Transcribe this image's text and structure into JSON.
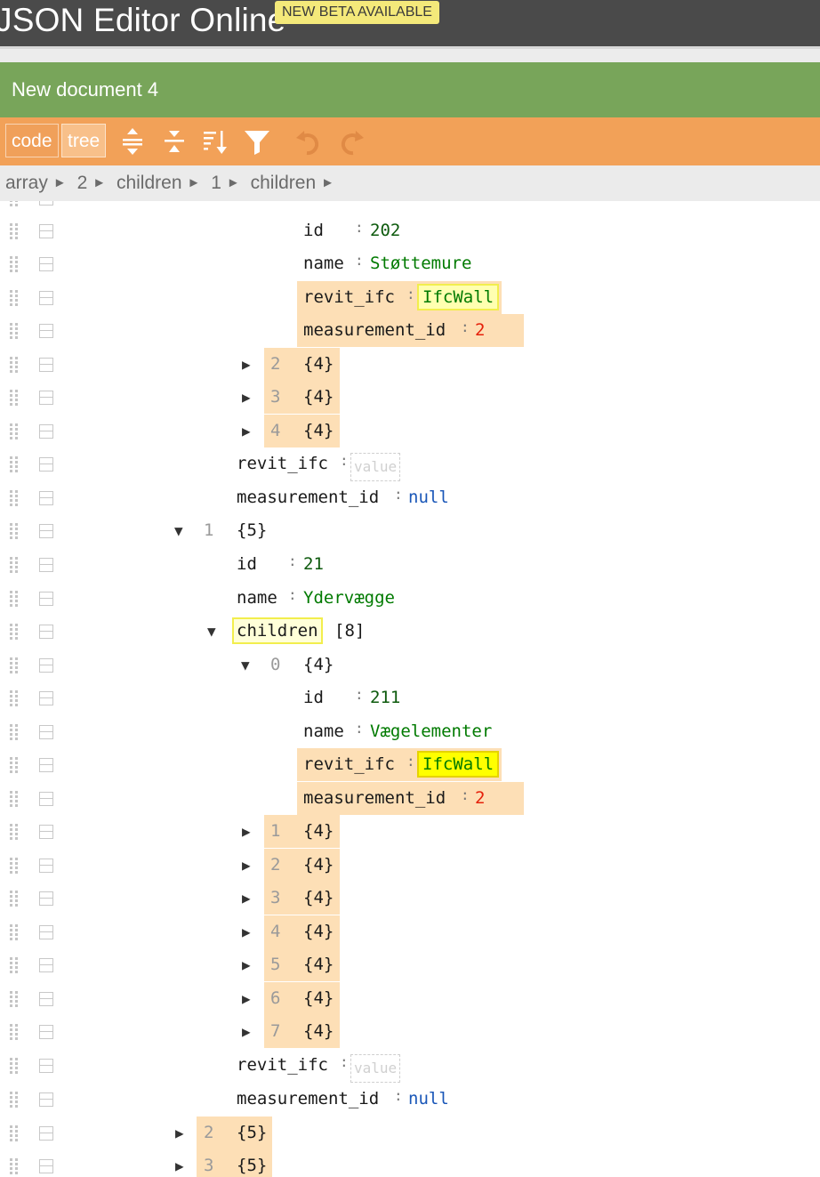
{
  "app": {
    "title_part1": "JSON Editor",
    "title_part2": " Online",
    "beta_badge": "NEW BETA AVAILABLE"
  },
  "document": {
    "title": "New document 4"
  },
  "toolbar": {
    "mode_code": "code",
    "mode_tree": "tree",
    "icons": [
      "expand-all-icon",
      "collapse-all-icon",
      "sort-icon",
      "filter-icon",
      "undo-icon",
      "redo-icon"
    ]
  },
  "breadcrumb": [
    "array",
    "2",
    "children",
    "1",
    "children"
  ],
  "breadcrumb_separator": "►",
  "tree": {
    "separator": ":",
    "rows": [
      {
        "key": "id",
        "value": "202"
      },
      {
        "key": "name",
        "value": "Støttemure"
      },
      {
        "key": "revit_ifc",
        "value": "IfcWall"
      },
      {
        "key": "measurement_id",
        "value": "2"
      },
      {
        "index": "2",
        "value": "{4}"
      },
      {
        "index": "3",
        "value": "{4}"
      },
      {
        "index": "4",
        "value": "{4}"
      },
      {
        "key": "revit_ifc",
        "placeholder": "value"
      },
      {
        "key": "measurement_id",
        "value": "null"
      },
      {
        "index": "1",
        "value": "{5}"
      },
      {
        "key": "id",
        "value": "21"
      },
      {
        "key": "name",
        "value": "Ydervægge"
      },
      {
        "key": "children",
        "value": "[8]"
      },
      {
        "index": "0",
        "value": "{4}"
      },
      {
        "key": "id",
        "value": "211"
      },
      {
        "key": "name",
        "value": "Vægelementer"
      },
      {
        "key": "revit_ifc",
        "value": "IfcWall"
      },
      {
        "key": "measurement_id",
        "value": "2"
      },
      {
        "index": "1",
        "value": "{4}"
      },
      {
        "index": "2",
        "value": "{4}"
      },
      {
        "index": "3",
        "value": "{4}"
      },
      {
        "index": "4",
        "value": "{4}"
      },
      {
        "index": "5",
        "value": "{4}"
      },
      {
        "index": "6",
        "value": "{4}"
      },
      {
        "index": "7",
        "value": "{4}"
      },
      {
        "key": "revit_ifc",
        "placeholder": "value"
      },
      {
        "key": "measurement_id",
        "value": "null"
      },
      {
        "index": "2",
        "value": "{5}"
      },
      {
        "index": "3",
        "value": "{5}"
      }
    ]
  },
  "colors": {
    "topbar": "#4a4a4a",
    "docbar": "#78a55a",
    "toolbar": "#f2a158",
    "highlight": "#fddfb6",
    "string": "#007a00",
    "number": "#e5200a",
    "null": "#1a57b8",
    "search_match": "#ffff66"
  }
}
